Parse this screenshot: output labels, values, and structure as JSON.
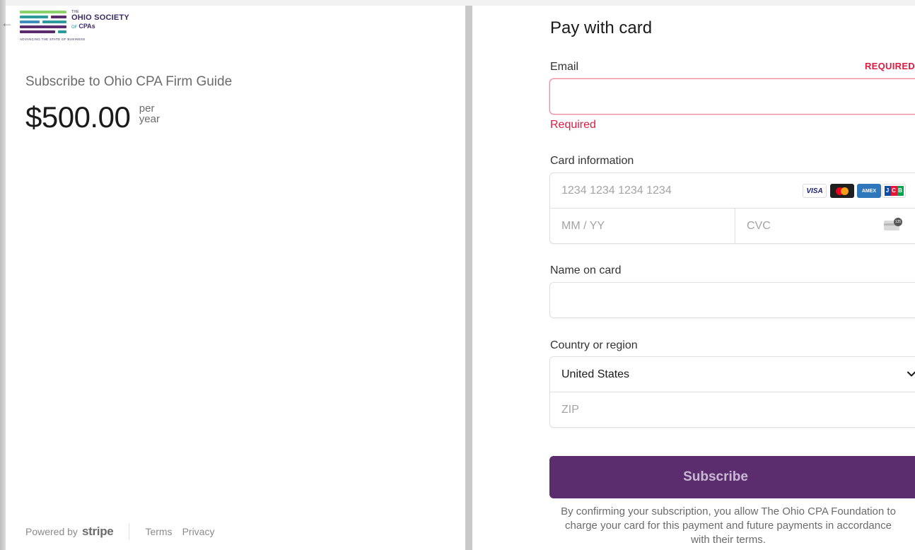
{
  "brand": {
    "logo_the": "THE",
    "logo_name": "OHIO SOCIETY",
    "logo_of": "OF",
    "logo_cpas": "CPAs",
    "logo_tagline": "ADVANCING THE STATE OF BUSINESS",
    "bar_colors": [
      "#8bd16a",
      "#2e9b9b",
      "#5b2d6e",
      "#3c8fbf"
    ]
  },
  "summary": {
    "title": "Subscribe to Ohio CPA Firm Guide",
    "price": "$500.00",
    "period_line1": "per",
    "period_line2": "year"
  },
  "footer": {
    "powered_by": "Powered by",
    "stripe": "stripe",
    "terms": "Terms",
    "privacy": "Privacy"
  },
  "form": {
    "title": "Pay with card",
    "email": {
      "label": "Email",
      "required_tag": "REQUIRED",
      "value": "",
      "error": "Required"
    },
    "card": {
      "label": "Card information",
      "number_placeholder": "1234 1234 1234 1234",
      "expiry_placeholder": "MM / YY",
      "cvc_placeholder": "CVC",
      "brands": [
        "VISA",
        "mastercard",
        "AMEX",
        "JCB"
      ],
      "cvc_icon_text": "135"
    },
    "name": {
      "label": "Name on card",
      "value": ""
    },
    "country": {
      "label": "Country or region",
      "selected": "United States",
      "zip_placeholder": "ZIP"
    },
    "submit_label": "Subscribe",
    "legal": "By confirming your subscription, you allow The Ohio CPA Foundation to charge your card for this payment and future payments in accordance with their terms."
  },
  "colors": {
    "accent": "#5b2d6e",
    "error": "#df1b41"
  }
}
